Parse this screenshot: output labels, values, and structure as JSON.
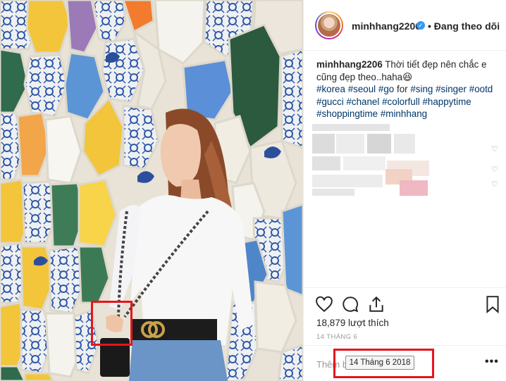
{
  "post": {
    "username": "minhhang2206",
    "follow_state": "• Đang theo dõi",
    "caption_user": "minhhang2206",
    "caption_text": "Thời tiết đẹp nên chắc e cũng đẹp theo..haha😆",
    "hashtags_line1": [
      "#korea",
      "#seoul",
      "#go"
    ],
    "caption_mid": "for",
    "hashtags_line2": [
      "#sing",
      "#singer",
      "#ootd"
    ],
    "hashtags_line3": [
      "#gucci",
      "#chanel",
      "#colorfull",
      "#happytime"
    ],
    "hashtags_line4": [
      "#shoppingtime",
      "#minhhang"
    ],
    "likes_text": "18,879 lượt thích",
    "date_small": "14 THÁNG 6",
    "comment_placeholder": "Thêm b",
    "date_tooltip": "14 Tháng 6 2018",
    "more_label": "•••"
  },
  "icons": {
    "verified": "✓",
    "like": "heart-outline-icon",
    "comment": "comment-bubble-icon",
    "share": "share-icon",
    "save": "bookmark-icon"
  },
  "colors": {
    "hashtag": "#003569",
    "verified": "#3897f0",
    "highlight": "#e8141c"
  }
}
